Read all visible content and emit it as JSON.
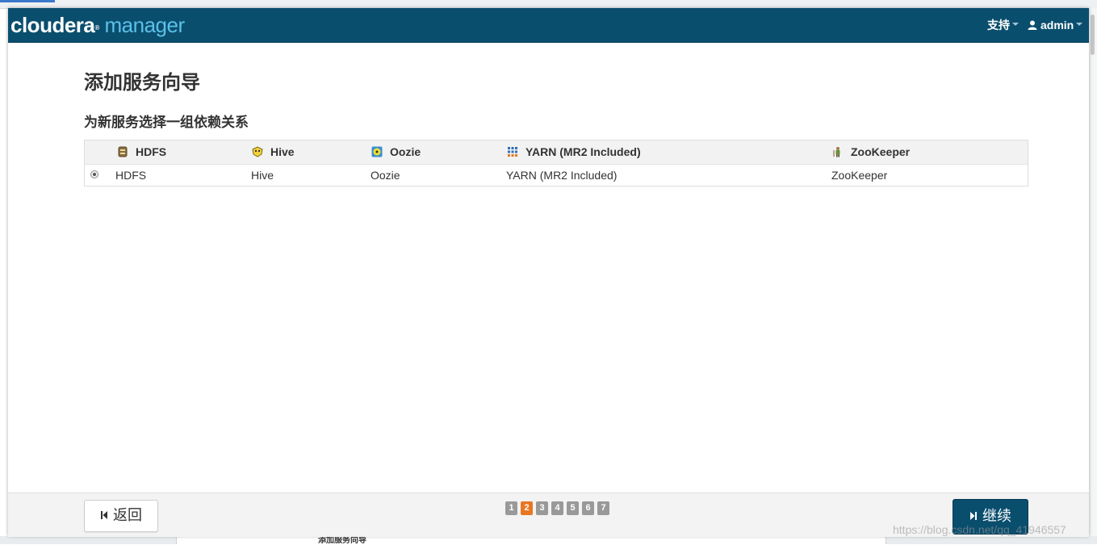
{
  "header": {
    "brand_primary": "cloudera",
    "brand_secondary": "manager",
    "support_label": "支持",
    "user_label": "admin"
  },
  "page": {
    "title": "添加服务向导",
    "subtitle": "为新服务选择一组依赖关系"
  },
  "table": {
    "columns": [
      {
        "label": "HDFS",
        "icon": "hdfs-icon"
      },
      {
        "label": "Hive",
        "icon": "hive-icon"
      },
      {
        "label": "Oozie",
        "icon": "oozie-icon"
      },
      {
        "label": "YARN (MR2 Included)",
        "icon": "yarn-icon"
      },
      {
        "label": "ZooKeeper",
        "icon": "zookeeper-icon"
      }
    ],
    "rows": [
      {
        "selected": true,
        "cells": [
          "HDFS",
          "Hive",
          "Oozie",
          "YARN (MR2 Included)",
          "ZooKeeper"
        ]
      }
    ]
  },
  "footer": {
    "back_label": "返回",
    "continue_label": "继续",
    "steps": [
      "1",
      "2",
      "3",
      "4",
      "5",
      "6",
      "7"
    ],
    "active_step": 2
  },
  "background": {
    "peek_title": "添加服务向导",
    "watermark": "https://blog.csdn.net/qq_41946557"
  },
  "colors": {
    "navbar": "#0a4e6e",
    "brand_accent": "#5cc0e8",
    "active_step": "#e87722",
    "inactive_step": "#999999"
  }
}
